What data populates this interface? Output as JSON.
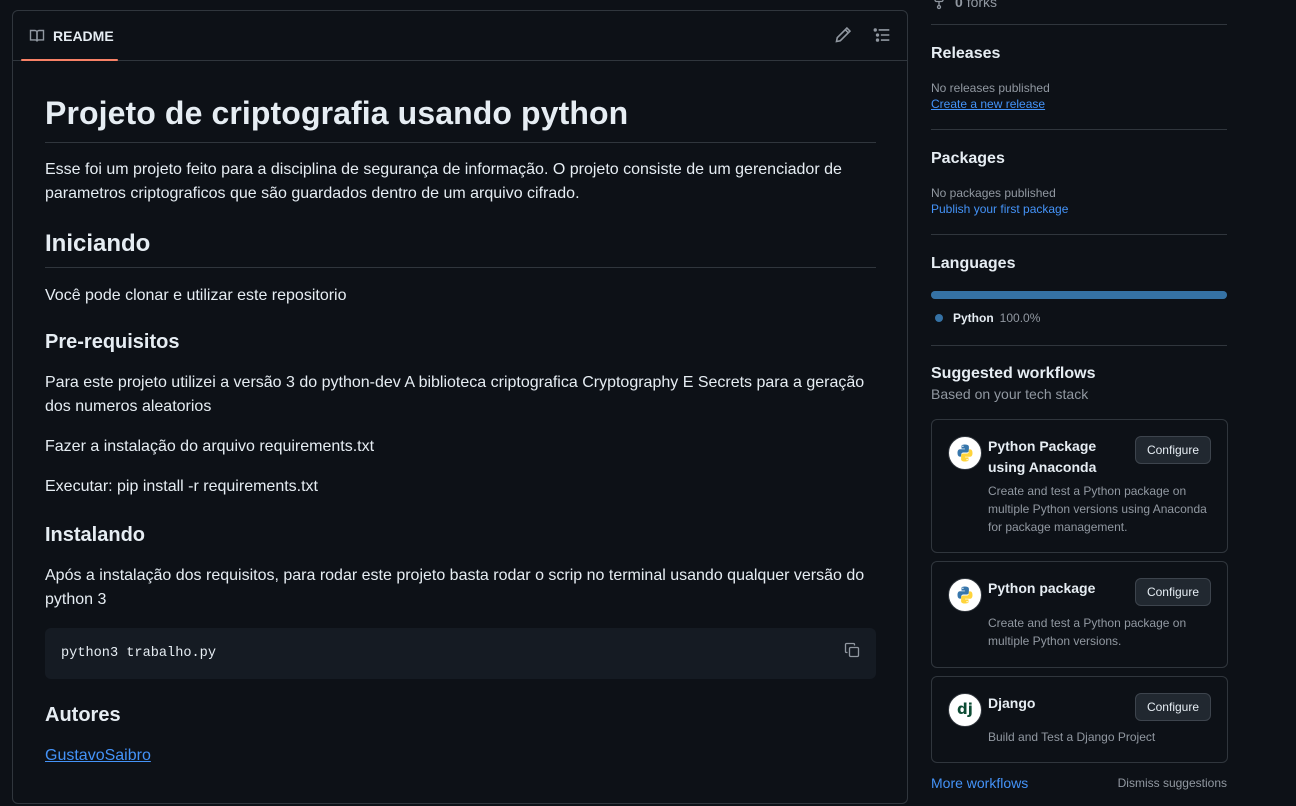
{
  "readme": {
    "tab_label": "README",
    "title": "Projeto de criptografia usando python",
    "intro": "Esse foi um projeto feito para a disciplina de segurança de informação. O projeto consiste de um gerenciador de parametros criptograficos que são guardados dentro de um arquivo cifrado.",
    "h_iniciando": "Iniciando",
    "p_iniciando": "Você pode clonar e utilizar este repositorio",
    "h_prereq": "Pre-requisitos",
    "p_prereq1": "Para este projeto utilizei a versão 3 do python-dev A biblioteca criptografica Cryptography E Secrets para a geração dos numeros aleatorios",
    "p_prereq2": "Fazer a instalação do arquivo requirements.txt",
    "p_prereq3": "Executar: pip install -r requirements.txt",
    "h_instalando": "Instalando",
    "p_instalando": "Após a instalação dos requisitos, para rodar este projeto basta rodar o scrip no terminal usando qualquer versão do python 3",
    "code": "python3 trabalho.py",
    "h_autores": "Autores",
    "author_link": "GustavoSaibro"
  },
  "sidebar": {
    "forks_count": "0",
    "forks_label": "forks",
    "releases": {
      "title": "Releases",
      "empty": "No releases published",
      "link": "Create a new release"
    },
    "packages": {
      "title": "Packages",
      "empty": "No packages published",
      "link": "Publish your first package"
    },
    "languages": {
      "title": "Languages",
      "items": [
        {
          "name": "Python",
          "percent": "100.0%",
          "fraction": 1.0,
          "color": "#3572a5"
        }
      ]
    },
    "workflows": {
      "title": "Suggested workflows",
      "subtitle": "Based on your tech stack",
      "cards": [
        {
          "title": "Python Package using Anaconda",
          "desc": "Create and test a Python package on multiple Python versions using Anaconda for package management.",
          "button": "Configure",
          "icon": "python-logo-icon"
        },
        {
          "title": "Python package",
          "desc": "Create and test a Python package on multiple Python versions.",
          "button": "Configure",
          "icon": "python-logo-icon"
        },
        {
          "title": "Django",
          "desc": "Build and Test a Django Project",
          "button": "Configure",
          "icon": "django-logo-icon"
        }
      ],
      "more_link": "More workflows",
      "dismiss": "Dismiss suggestions"
    }
  },
  "colors": {
    "accent_tab": "#f78166",
    "link": "#4493f8",
    "python": "#3572a5",
    "django": "#0c4b33"
  }
}
